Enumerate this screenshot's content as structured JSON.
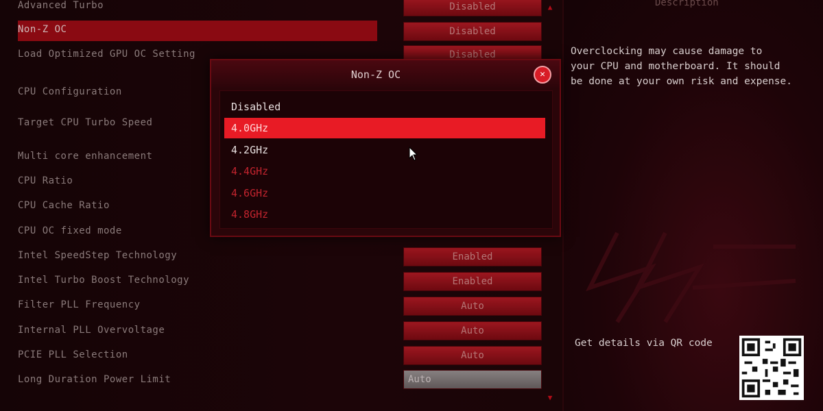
{
  "settings": [
    {
      "label": "Advanced Turbo",
      "value": "Disabled"
    },
    {
      "label": "Non-Z OC",
      "value": "Disabled",
      "selected": true
    },
    {
      "label": "Load Optimized GPU OC Setting",
      "value": "Disabled"
    },
    {
      "label": "CPU Configuration"
    },
    {
      "label": "Target CPU Turbo Speed"
    },
    {
      "label": "Multi core enhancement"
    },
    {
      "label": "CPU Ratio"
    },
    {
      "label": "CPU Cache Ratio"
    },
    {
      "label": "CPU OC fixed mode"
    },
    {
      "label": "Intel SpeedStep Technology",
      "value": "Enabled"
    },
    {
      "label": "Intel Turbo Boost Technology",
      "value": "Enabled"
    },
    {
      "label": "Filter PLL Frequency",
      "value": "Auto"
    },
    {
      "label": "Internal PLL Overvoltage",
      "value": "Auto"
    },
    {
      "label": "PCIE PLL Selection",
      "value": "Auto"
    },
    {
      "label": "Long Duration Power Limit",
      "value": "Auto"
    }
  ],
  "modal": {
    "title": "Non-Z OC",
    "options": [
      {
        "label": "Disabled",
        "state": "normal"
      },
      {
        "label": "4.0GHz",
        "state": "active"
      },
      {
        "label": "4.2GHz",
        "state": "normal"
      },
      {
        "label": "4.4GHz",
        "state": "disabled"
      },
      {
        "label": "4.6GHz",
        "state": "disabled"
      },
      {
        "label": "4.8GHz",
        "state": "disabled"
      }
    ]
  },
  "description": {
    "title": "Description",
    "text": "Overclocking may cause damage to\nyour CPU and motherboard. It should\nbe done at your own risk and expense.",
    "qr_label": "Get details via QR code"
  },
  "colors": {
    "accent": "#e81b25",
    "selected_row": "#8a0a12",
    "button": "#9a121b"
  }
}
